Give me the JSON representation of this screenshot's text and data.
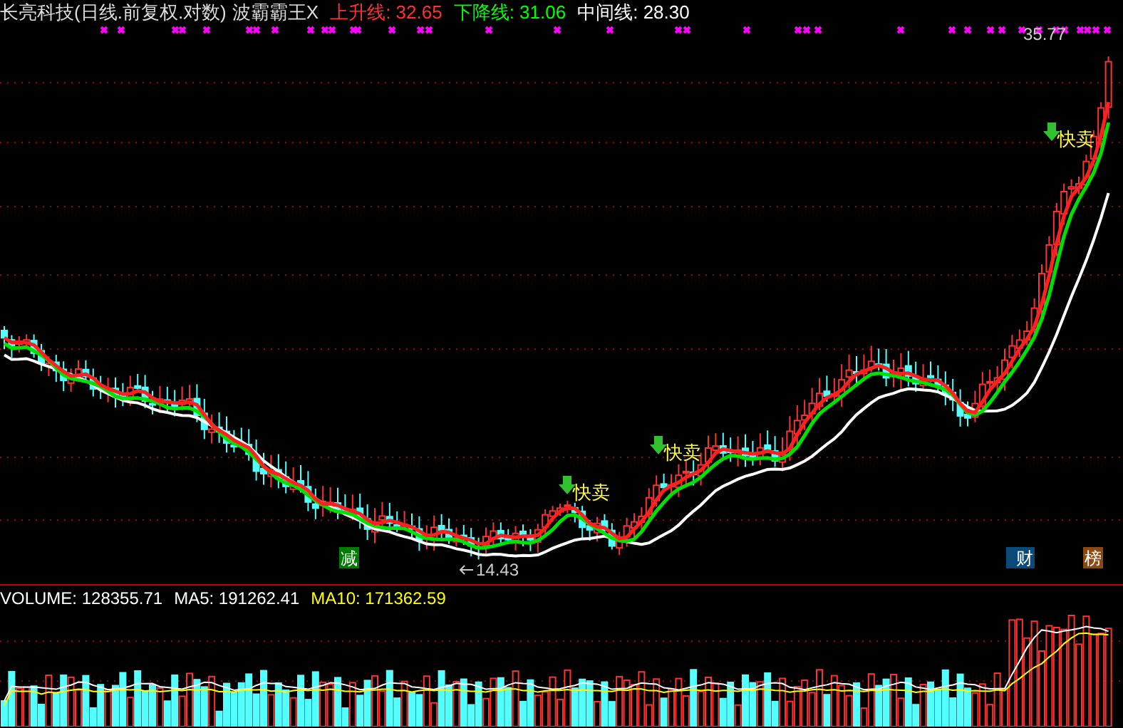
{
  "title": {
    "stock": "长亮科技(日线.前复权.对数)",
    "indicator": "波霸霸王X"
  },
  "legend": [
    {
      "label": "上升线:",
      "value": "32.65",
      "color": "#ff3030"
    },
    {
      "label": "下降线:",
      "value": "31.06",
      "color": "#00ff00"
    },
    {
      "label": "中间线:",
      "value": "28.30",
      "color": "#ffffff"
    }
  ],
  "signals": [
    {
      "kind": "sell",
      "text": "快卖"
    },
    {
      "kind": "sell",
      "text": "快卖"
    },
    {
      "kind": "sell",
      "text": "快卖"
    }
  ],
  "price_labels": [
    {
      "kind": "high",
      "text": "35.77"
    },
    {
      "kind": "low",
      "text": "14.43"
    }
  ],
  "badges": [
    {
      "text": "减",
      "color": "#007a00"
    },
    {
      "text": "财",
      "color": "#0a4a7a"
    },
    {
      "text": "榜",
      "color": "#8b4a14"
    }
  ],
  "volume_legend": [
    {
      "label": "VOLUME:",
      "value": "128355.71",
      "color": "#ffffff"
    },
    {
      "label": "MA5:",
      "value": "191262.41",
      "color": "#ffffff"
    },
    {
      "label": "MA10:",
      "value": "171362.59",
      "color": "#ffff00"
    }
  ]
}
